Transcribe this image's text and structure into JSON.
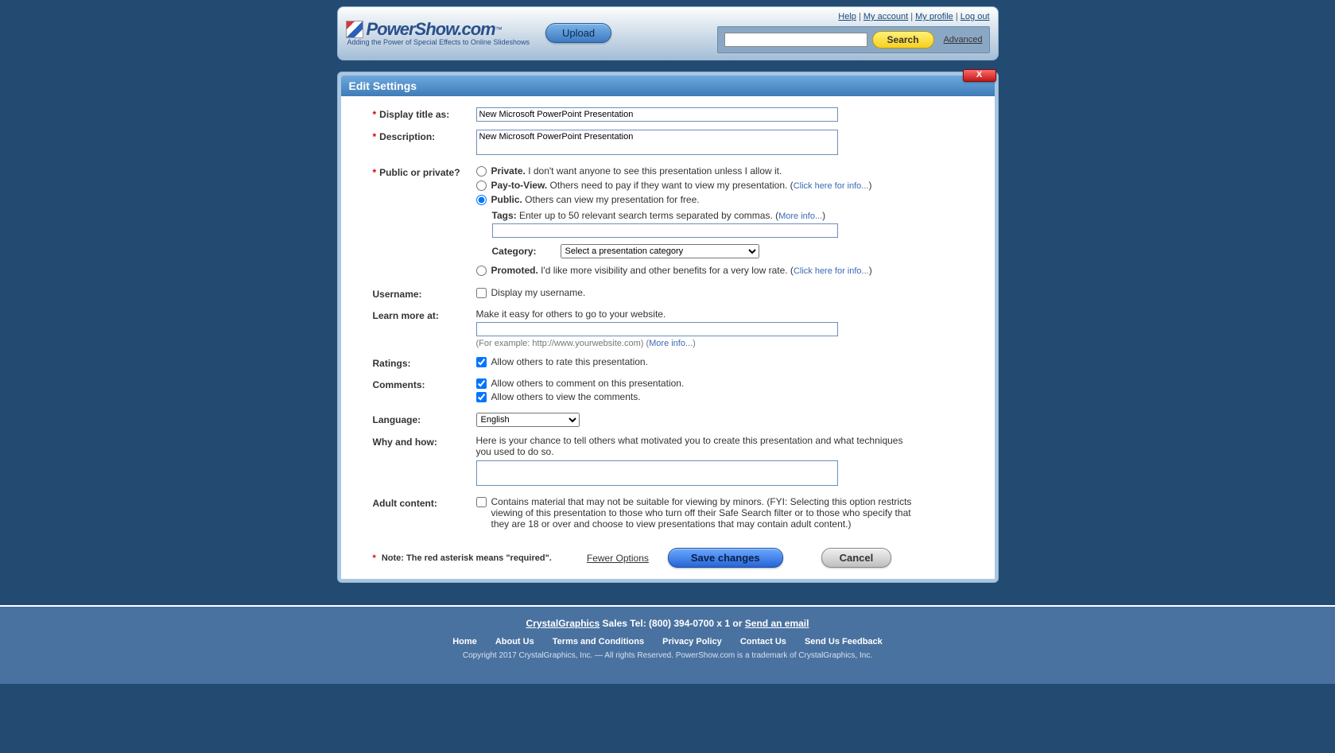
{
  "header": {
    "logo_main": "PowerShow.com",
    "logo_tm": "™",
    "logo_sub": "Adding the Power of Special Effects to Online Slideshows",
    "upload_label": "Upload",
    "top_links": [
      "Help",
      "My account",
      "My profile",
      "Log out"
    ],
    "search_button": "Search",
    "advanced": "Advanced"
  },
  "panel": {
    "title": "Edit Settings",
    "close": "X"
  },
  "form": {
    "display_title": {
      "label": "Display title as:",
      "value": "New Microsoft PowerPoint Presentation"
    },
    "description": {
      "label": "Description:",
      "value": "New Microsoft PowerPoint Presentation"
    },
    "privacy": {
      "label": "Public or private?",
      "private_bold": "Private.",
      "private_text": " I don't want anyone to see this presentation unless I allow it.",
      "pay_bold": "Pay-to-View.",
      "pay_text": " Others need to pay if they want to view my presentation. (",
      "pay_link": "Click here for info...",
      "public_bold": "Public.",
      "public_text": " Others can view my presentation for free.",
      "tags_bold": "Tags:",
      "tags_text": " Enter up to 50 relevant search terms separated by commas. (",
      "tags_link": "More info...",
      "category_label": "Category:",
      "category_placeholder": "Select a presentation category",
      "promoted_bold": "Promoted.",
      "promoted_text": " I'd like more visibility and other benefits for a very low rate. (",
      "promoted_link": "Click here for info..."
    },
    "username": {
      "label": "Username:",
      "check": "Display my username."
    },
    "learn_more": {
      "label": "Learn more at:",
      "hint": "Make it easy for others to go to your website.",
      "example": "(For example: http://www.yourwebsite.com) (",
      "link": "More info..."
    },
    "ratings": {
      "label": "Ratings:",
      "check": "Allow others to rate this presentation."
    },
    "comments": {
      "label": "Comments:",
      "check1": "Allow others to comment on this presentation.",
      "check2": "Allow others to view the comments."
    },
    "language": {
      "label": "Language:",
      "value": "English"
    },
    "why": {
      "label": "Why and how:",
      "hint": "Here is your chance to tell others what motivated you to create this presentation and what techniques you used to do so."
    },
    "adult": {
      "label": "Adult content:",
      "text": "Contains material that may not be suitable for viewing by minors. (FYI: Selecting this option restricts viewing of this presentation to those who turn off their Safe Search filter or to those who specify that they are 18 or over and choose to view presentations that may contain adult content.)"
    },
    "note": "Note: The red asterisk means \"required\".",
    "fewer": "Fewer Options",
    "save": "Save changes",
    "cancel": "Cancel"
  },
  "footer": {
    "cg": "CrystalGraphics",
    "sales": " Sales Tel: (800) 394-0700 x 1 or ",
    "email": "Send an email",
    "links": [
      "Home",
      "About Us",
      "Terms and Conditions",
      "Privacy Policy",
      "Contact Us",
      "Send Us Feedback"
    ],
    "copyright": "Copyright 2017 CrystalGraphics, Inc. — All rights Reserved. PowerShow.com is a trademark of CrystalGraphics, Inc."
  }
}
